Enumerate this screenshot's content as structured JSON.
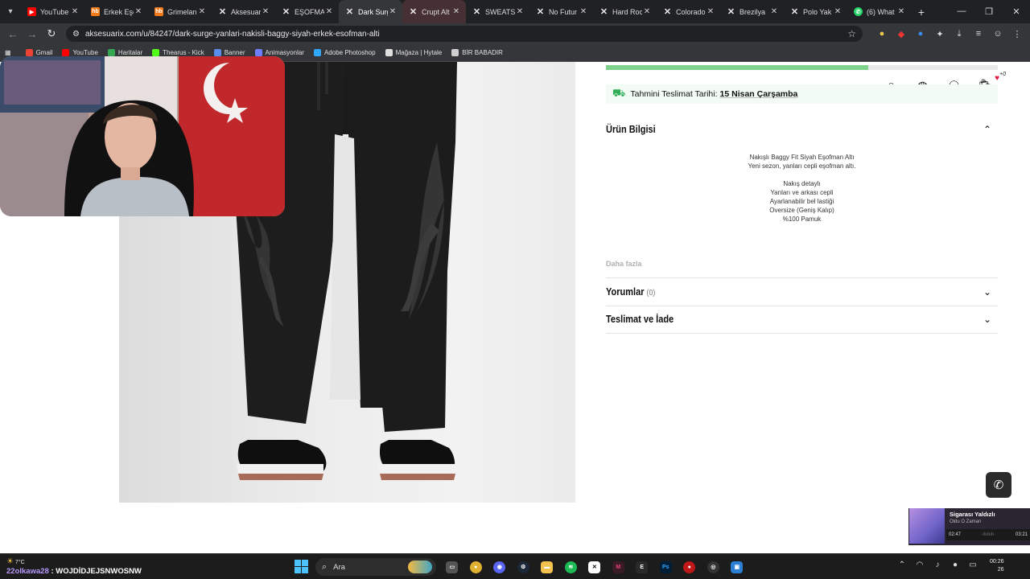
{
  "browser": {
    "tabs": [
      {
        "title": "YouTube",
        "favicon": "youtube-icon",
        "active": false
      },
      {
        "title": "Erkek Eşo",
        "favicon": "hb-icon",
        "active": false
      },
      {
        "title": "Grimelan",
        "favicon": "hb-icon",
        "active": false
      },
      {
        "title": "Aksesuar",
        "favicon": "x-icon",
        "active": false
      },
      {
        "title": "EŞOFMA",
        "favicon": "x-icon",
        "active": false
      },
      {
        "title": "Dark Surg",
        "favicon": "x-icon",
        "active": true
      },
      {
        "title": "Crupt Alt",
        "favicon": "x-icon",
        "active": false,
        "hovered": true
      },
      {
        "title": "SWEATSH",
        "favicon": "x-icon",
        "active": false
      },
      {
        "title": "No Futur",
        "favicon": "x-icon",
        "active": false
      },
      {
        "title": "Hard Roc",
        "favicon": "x-icon",
        "active": false
      },
      {
        "title": "Colorado",
        "favicon": "x-icon",
        "active": false
      },
      {
        "title": "Brezilya",
        "favicon": "x-icon",
        "active": false
      },
      {
        "title": "Polo Yak",
        "favicon": "x-icon",
        "active": false
      },
      {
        "title": "(6) What",
        "favicon": "whatsapp-icon",
        "active": false
      }
    ],
    "url": "aksesuarix.com/u/84247/dark-surge-yanlari-nakisli-baggy-siyah-erkek-esofman-alti",
    "bookmarks": [
      {
        "label": "Gmail",
        "color": "#ea4335"
      },
      {
        "label": "YouTube",
        "color": "#ff0000"
      },
      {
        "label": "Haritalar",
        "color": "#34a853"
      },
      {
        "label": "Thearus - Kick",
        "color": "#53fc18"
      },
      {
        "label": "Banner",
        "color": "#5b8def"
      },
      {
        "label": "Animasyonlar",
        "color": "#6f7dff"
      },
      {
        "label": "Adobe Photoshop",
        "color": "#31a8ff"
      },
      {
        "label": "Mağaza | Hytale",
        "color": "#e0e0e0"
      },
      {
        "label": "BİR BABADIR",
        "color": "#d0d0d0"
      }
    ]
  },
  "page": {
    "delivery_label": "Tahmini Teslimat Tarihi:",
    "delivery_date": "15 Nisan Çarşamba",
    "cart_count": "+0",
    "progress_fraction": 0.67,
    "product_info": {
      "title": "Ürün Bilgisi",
      "lines": [
        "Nakışlı Baggy Fit Siyah Eşofman Altı",
        "Yeni sezon, yanları cepli eşofman altı.",
        "",
        "Nakış detaylı",
        "Yanları ve arkası cepli",
        "Ayarlanabilir bel lastiği",
        "Oversize (Geniş Kalıp)",
        "%100 Pamuk"
      ],
      "more": "Daha fazla"
    },
    "reviews": {
      "title": "Yorumlar",
      "count": "(0)"
    },
    "shipping": {
      "title": "Teslimat ve İade"
    }
  },
  "media_player": {
    "song": "Sigarası Yaldızlı",
    "artist": "Oldu O Zaman",
    "elapsed": "02:47",
    "duration": "03:21"
  },
  "taskbar": {
    "temperature": "7°C",
    "overlay_user": "olkawa28",
    "overlay_prefix": "22",
    "overlay_message": ": WOJDİDJEJSNWOSNW",
    "search_placeholder": "Ara",
    "time": "00:26",
    "date": "26"
  },
  "colors": {
    "accent_green": "#2fae55",
    "tab_bar": "#202124",
    "toolbar": "#35363a"
  }
}
